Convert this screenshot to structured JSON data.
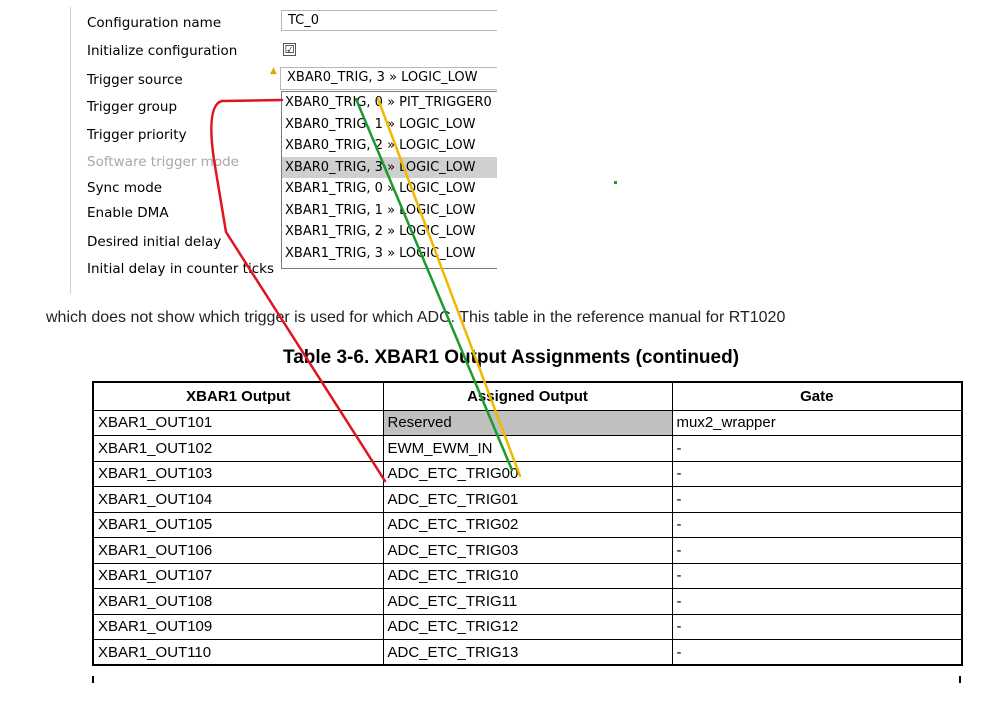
{
  "config_panel": {
    "rows": [
      {
        "label": "Configuration name"
      },
      {
        "label": "Initialize configuration"
      },
      {
        "label": "Trigger source"
      },
      {
        "label": "Trigger group"
      },
      {
        "label": "Trigger priority"
      },
      {
        "label": "Software trigger mode"
      },
      {
        "label": "Sync mode"
      },
      {
        "label": "Enable DMA"
      },
      {
        "label": "Desired initial delay"
      },
      {
        "label": "Initial delay in counter ticks"
      }
    ],
    "configuration_name_value": "TC_0",
    "initialize_checked": "☑",
    "trigger_source_value": "XBAR0_TRIG, 3 » LOGIC_LOW",
    "dropdown_options": [
      "XBAR0_TRIG, 0 » PIT_TRIGGER0",
      "XBAR0_TRIG, 1 » LOGIC_LOW",
      "XBAR0_TRIG, 2 » LOGIC_LOW",
      "XBAR0_TRIG, 3 » LOGIC_LOW",
      "XBAR1_TRIG, 0 » LOGIC_LOW",
      "XBAR1_TRIG, 1 » LOGIC_LOW",
      "XBAR1_TRIG, 2 » LOGIC_LOW",
      "XBAR1_TRIG, 3 » LOGIC_LOW"
    ],
    "selected_option_index": 3,
    "warning_icon": "warning-icon"
  },
  "sentence": "which does not show which trigger is used for which ADC. This table in the reference manual for RT1020",
  "table": {
    "caption": "Table 3-6.  XBAR1 Output Assignments (continued)",
    "headers": [
      "XBAR1 Output",
      "Assigned Output",
      "Gate"
    ],
    "rows": [
      [
        "XBAR1_OUT101",
        "Reserved",
        "mux2_wrapper"
      ],
      [
        "XBAR1_OUT102",
        "EWM_EWM_IN",
        "-"
      ],
      [
        "XBAR1_OUT103",
        "ADC_ETC_TRIG00",
        "-"
      ],
      [
        "XBAR1_OUT104",
        "ADC_ETC_TRIG01",
        "-"
      ],
      [
        "XBAR1_OUT105",
        "ADC_ETC_TRIG02",
        "-"
      ],
      [
        "XBAR1_OUT106",
        "ADC_ETC_TRIG03",
        "-"
      ],
      [
        "XBAR1_OUT107",
        "ADC_ETC_TRIG10",
        "-"
      ],
      [
        "XBAR1_OUT108",
        "ADC_ETC_TRIG11",
        "-"
      ],
      [
        "XBAR1_OUT109",
        "ADC_ETC_TRIG12",
        "-"
      ],
      [
        "XBAR1_OUT110",
        "ADC_ETC_TRIG13",
        "-"
      ]
    ]
  },
  "annotation_colors": {
    "red": "#e0141e",
    "green": "#1a9b2e",
    "yellow": "#f2b800"
  }
}
